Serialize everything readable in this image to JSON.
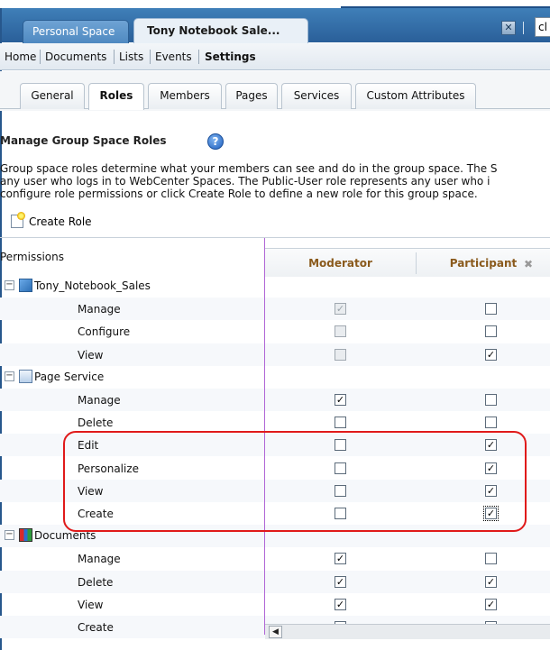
{
  "top_tabs": {
    "personal_space": "Personal Space",
    "group_space": "Tony Notebook Sale..."
  },
  "window": {
    "close_icon": "close-icon",
    "search_value": "cl"
  },
  "nav": {
    "home": "Home",
    "documents": "Documents",
    "lists": "Lists",
    "events": "Events",
    "settings": "Settings"
  },
  "settings_tabs": [
    "General",
    "Roles",
    "Members",
    "Pages",
    "Services",
    "Custom Attributes"
  ],
  "active_settings_tab": "Roles",
  "page": {
    "heading": "Manage Group Space Roles",
    "help_icon": "?",
    "description_lines": [
      "Group space roles determine what your members can see and do in the group space. The S",
      "any user who logs in to WebCenter Spaces. The Public-User role represents any user who i",
      "configure role permissions or click Create Role to define a new role for this group space."
    ],
    "create_role": "Create Role"
  },
  "table": {
    "permissions_header": "Permissions",
    "columns": [
      "Moderator",
      "Participant"
    ],
    "remove_icon": "✖",
    "groups": [
      {
        "name": "Tony_Notebook_Sales",
        "icon": "group-space-icon",
        "rows": [
          {
            "label": "Manage",
            "moderator": "checked-disabled",
            "participant": "unchecked"
          },
          {
            "label": "Configure",
            "moderator": "unchecked-disabled",
            "participant": "unchecked"
          },
          {
            "label": "View",
            "moderator": "unchecked-disabled",
            "participant": "checked"
          }
        ]
      },
      {
        "name": "Page Service",
        "icon": "page-service-icon",
        "rows": [
          {
            "label": "Manage",
            "moderator": "checked",
            "participant": "unchecked"
          },
          {
            "label": "Delete",
            "moderator": "unchecked",
            "participant": "unchecked"
          },
          {
            "label": "Edit",
            "moderator": "unchecked",
            "participant": "checked"
          },
          {
            "label": "Personalize",
            "moderator": "unchecked",
            "participant": "checked"
          },
          {
            "label": "View",
            "moderator": "unchecked",
            "participant": "checked"
          },
          {
            "label": "Create",
            "moderator": "unchecked",
            "participant": "checked-focused"
          }
        ]
      },
      {
        "name": "Documents",
        "icon": "documents-icon",
        "rows": [
          {
            "label": "Manage",
            "moderator": "checked",
            "participant": "unchecked"
          },
          {
            "label": "Delete",
            "moderator": "checked",
            "participant": "checked"
          },
          {
            "label": "View",
            "moderator": "checked",
            "participant": "checked"
          },
          {
            "label": "Create",
            "moderator": "checked",
            "participant": "checked"
          }
        ]
      }
    ]
  },
  "scrollbar": {
    "left_arrow": "◀"
  },
  "colors": {
    "top_bar": "#2a5f99",
    "accent_column_header": "#8a5a1c",
    "highlight_box": "#e01a1a",
    "column_divider": "#b066d6"
  }
}
